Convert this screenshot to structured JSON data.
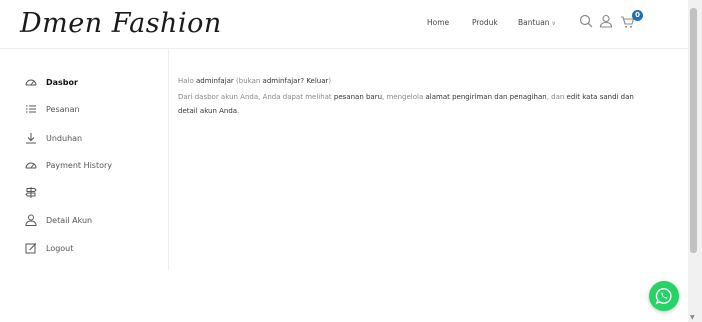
{
  "header": {
    "logo": "Dmen Fashion",
    "nav": {
      "home": "Home",
      "produk": "Produk",
      "bantuan": "Bantuan"
    },
    "cart_count": "0"
  },
  "sidebar": {
    "items": [
      {
        "label": "Dasbor",
        "icon": "dashboard-icon",
        "active": true
      },
      {
        "label": "Pesanan",
        "icon": "list-icon"
      },
      {
        "label": "Unduhan",
        "icon": "download-icon"
      },
      {
        "label": "Payment History",
        "icon": "dashboard-icon"
      },
      {
        "label": "",
        "icon": "signpost-icon"
      },
      {
        "label": "Detail Akun",
        "icon": "user-icon"
      },
      {
        "label": "Logout",
        "icon": "edit-icon"
      }
    ]
  },
  "main": {
    "greeting_prefix": "Halo ",
    "username": "adminfajar",
    "greeting_mid": " (bukan ",
    "username2": "adminfajar",
    "greeting_q": "? ",
    "logout_link": "Keluar",
    "greeting_close": ")",
    "desc_1": "Dari dasbor akun Anda, Anda dapat melihat ",
    "link_orders": "pesanan baru",
    "desc_2": ", mengelola ",
    "link_addresses": "alamat pengiriman dan penagihan",
    "desc_3": ", dan ",
    "link_account": "edit kata sandi dan detail akun Anda",
    "desc_4": "."
  },
  "colors": {
    "badge": "#1f6fb5",
    "whatsapp": "#25d366"
  }
}
